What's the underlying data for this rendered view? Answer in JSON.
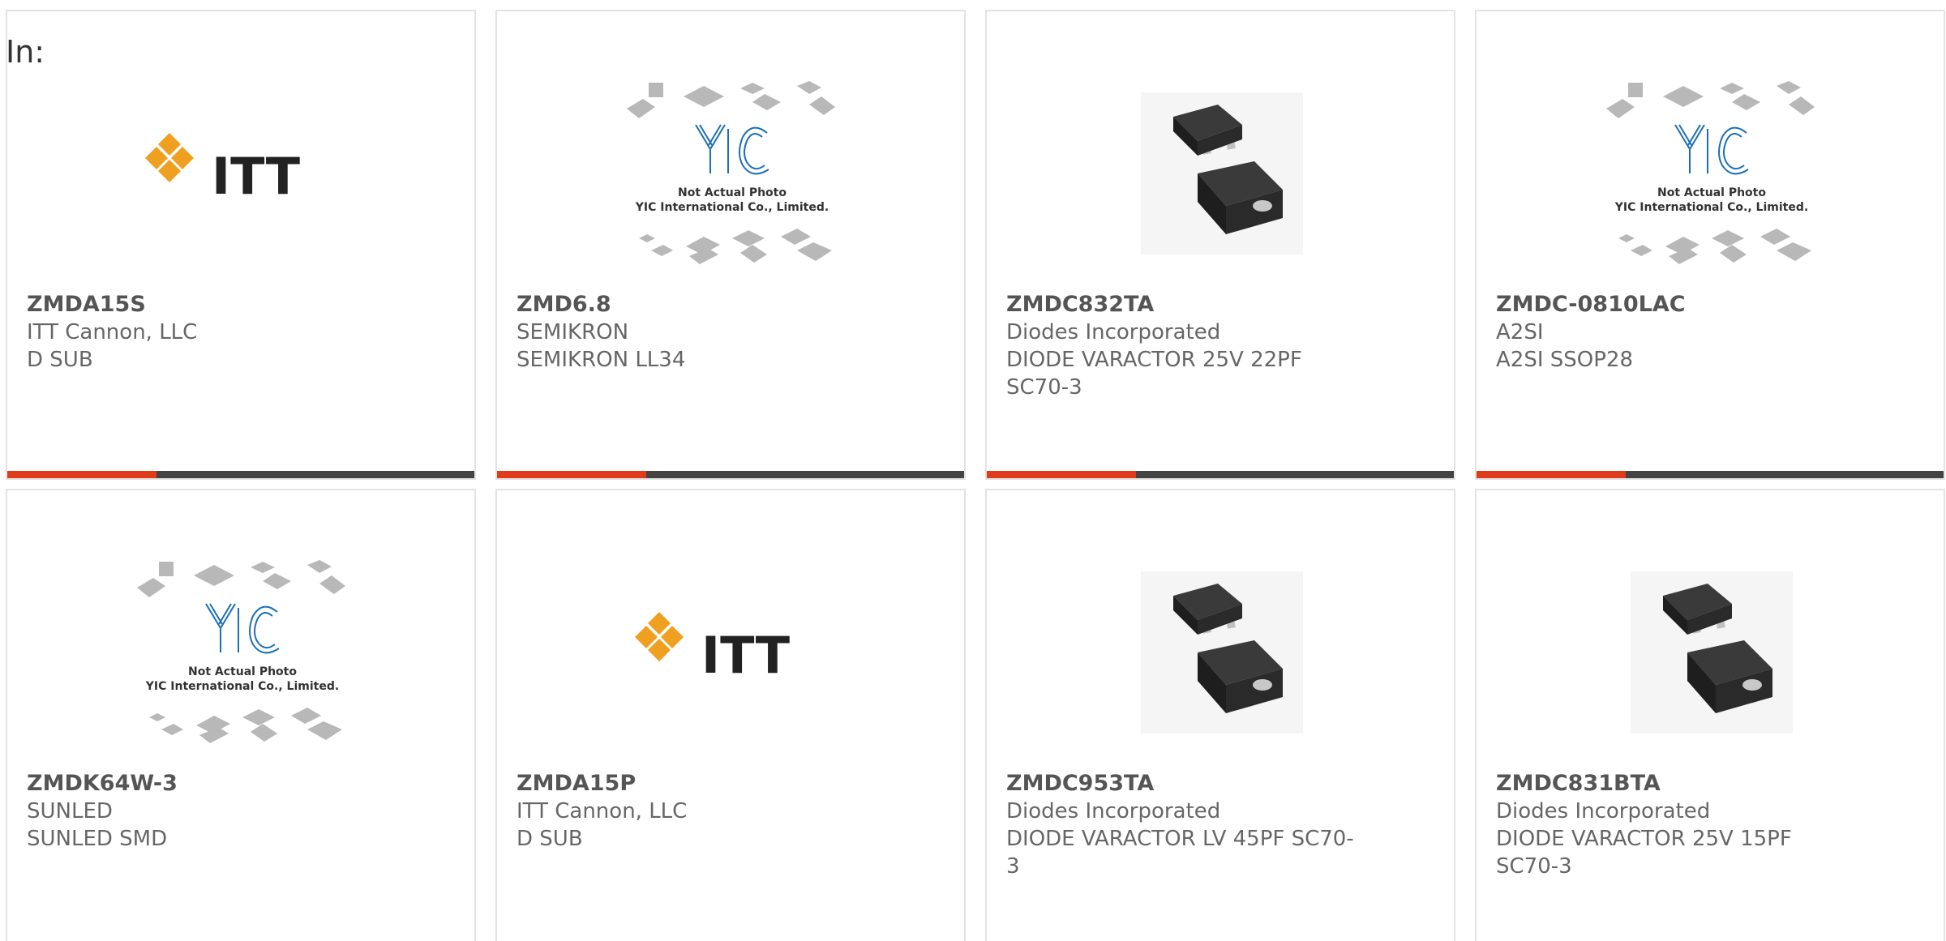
{
  "in_label": "In:",
  "colors": {
    "accent": "#e03c19",
    "bar": "#444444",
    "itt_orange": "#f0a020",
    "yic_blue": "#1a6fb8"
  },
  "logos": {
    "itt": {
      "text": "ITT"
    },
    "yic": {
      "caption_1": "Not Actual Photo",
      "caption_2": "YIC International Co., Limited."
    }
  },
  "products": [
    {
      "part": "ZMDA15S",
      "maker": "ITT Cannon, LLC",
      "desc": "D SUB",
      "image": "itt-logo"
    },
    {
      "part": "ZMD6.8",
      "maker": "SEMIKRON",
      "desc": "SEMIKRON LL34",
      "image": "yic-placeholder"
    },
    {
      "part": "ZMDC832TA",
      "maker": "Diodes Incorporated",
      "desc": "DIODE VARACTOR 25V 22PF SC70-3",
      "image": "sc70-chip"
    },
    {
      "part": "ZMDC-0810LAC",
      "maker": "A2SI",
      "desc": "A2SI SSOP28",
      "image": "yic-placeholder"
    },
    {
      "part": "ZMDK64W-3",
      "maker": "SUNLED",
      "desc": "SUNLED SMD",
      "image": "yic-placeholder"
    },
    {
      "part": "ZMDA15P",
      "maker": "ITT Cannon, LLC",
      "desc": "D SUB",
      "image": "itt-logo"
    },
    {
      "part": "ZMDC953TA",
      "maker": "Diodes Incorporated",
      "desc": "DIODE VARACTOR LV 45PF SC70-3",
      "image": "sc70-chip"
    },
    {
      "part": "ZMDC831BTA",
      "maker": "Diodes Incorporated",
      "desc": "DIODE VARACTOR 25V 15PF SC70-3",
      "image": "sc70-chip"
    }
  ]
}
